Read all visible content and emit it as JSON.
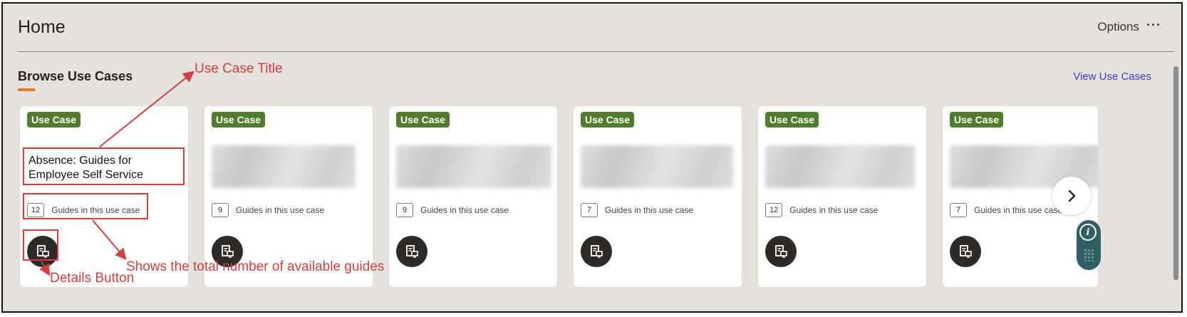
{
  "header": {
    "title": "Home",
    "options_label": "Options",
    "options_icon": "···"
  },
  "section": {
    "title": "Browse Use Cases",
    "view_link": "View Use Cases",
    "accent_color": "#e87b1f"
  },
  "cards": [
    {
      "badge": "Use Case",
      "title": "Absence: Guides for Employee Self Service",
      "guides_count": "12",
      "guides_label": "Guides in this use case"
    },
    {
      "badge": "Use Case",
      "title": "",
      "guides_count": "9",
      "guides_label": "Guides in this use case"
    },
    {
      "badge": "Use Case",
      "title": "",
      "guides_count": "9",
      "guides_label": "Guides in this use case"
    },
    {
      "badge": "Use Case",
      "title": "",
      "guides_count": "7",
      "guides_label": "Guides in this use case"
    },
    {
      "badge": "Use Case",
      "title": "",
      "guides_count": "12",
      "guides_label": "Guides in this use case"
    },
    {
      "badge": "Use Case",
      "title": "",
      "guides_count": "7",
      "guides_label": "Guides in this use case"
    }
  ],
  "annotations": {
    "use_case_title": "Use Case Title",
    "total_guides": "Shows the total number of available guides",
    "details_button": "Details Button"
  },
  "colors": {
    "badge": "#4f7d2b",
    "annotation": "#d63d3d",
    "help_widget": "#2f5f63"
  },
  "icons": {
    "details": "document-view-icon",
    "next": "chevron-right-icon",
    "help": "info-icon"
  }
}
